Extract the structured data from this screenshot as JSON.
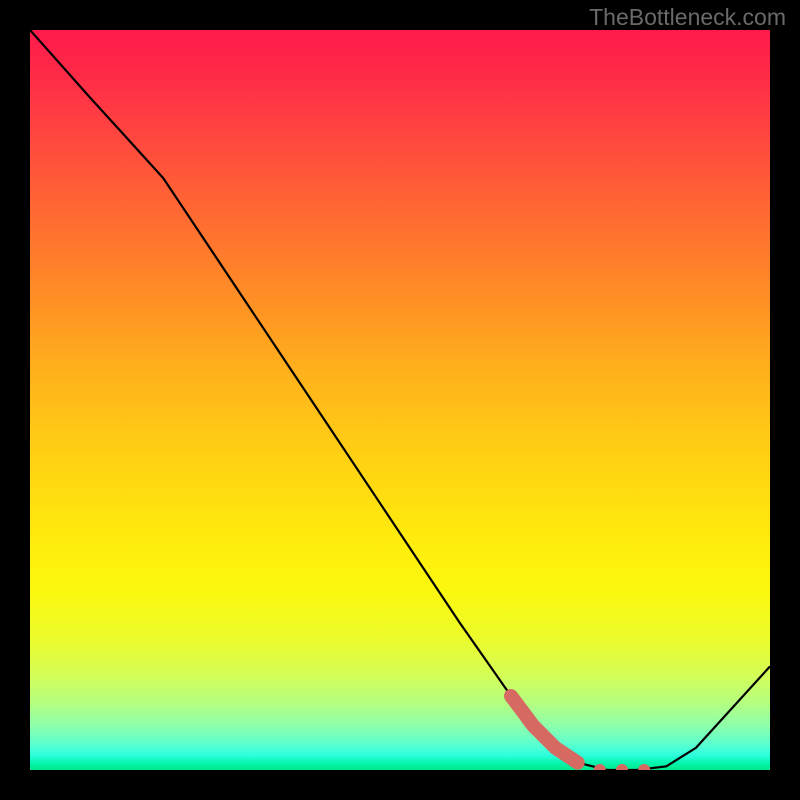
{
  "watermark": "TheBottleneck.com",
  "chart_data": {
    "type": "line",
    "title": "",
    "xlabel": "",
    "ylabel": "",
    "xlim": [
      0,
      100
    ],
    "ylim": [
      0,
      100
    ],
    "grid": false,
    "series": [
      {
        "name": "bottleneck-curve",
        "color": "#000000",
        "x": [
          0,
          8,
          18,
          28,
          38,
          48,
          58,
          65,
          70,
          74,
          78,
          82,
          86,
          90,
          100
        ],
        "y": [
          100,
          91,
          80,
          65,
          50,
          35,
          20,
          10,
          4,
          1,
          0,
          0,
          0.5,
          3,
          14
        ]
      },
      {
        "name": "highlight-segment",
        "color": "#d66a62",
        "style": "thick-dotted",
        "x": [
          65,
          68,
          71,
          74,
          77,
          80,
          83
        ],
        "y": [
          10,
          6,
          3,
          1,
          0,
          0,
          0
        ]
      }
    ],
    "background_gradient": {
      "top": "#ff1a4b",
      "mid": "#ffee0c",
      "bottom": "#00e889"
    }
  }
}
